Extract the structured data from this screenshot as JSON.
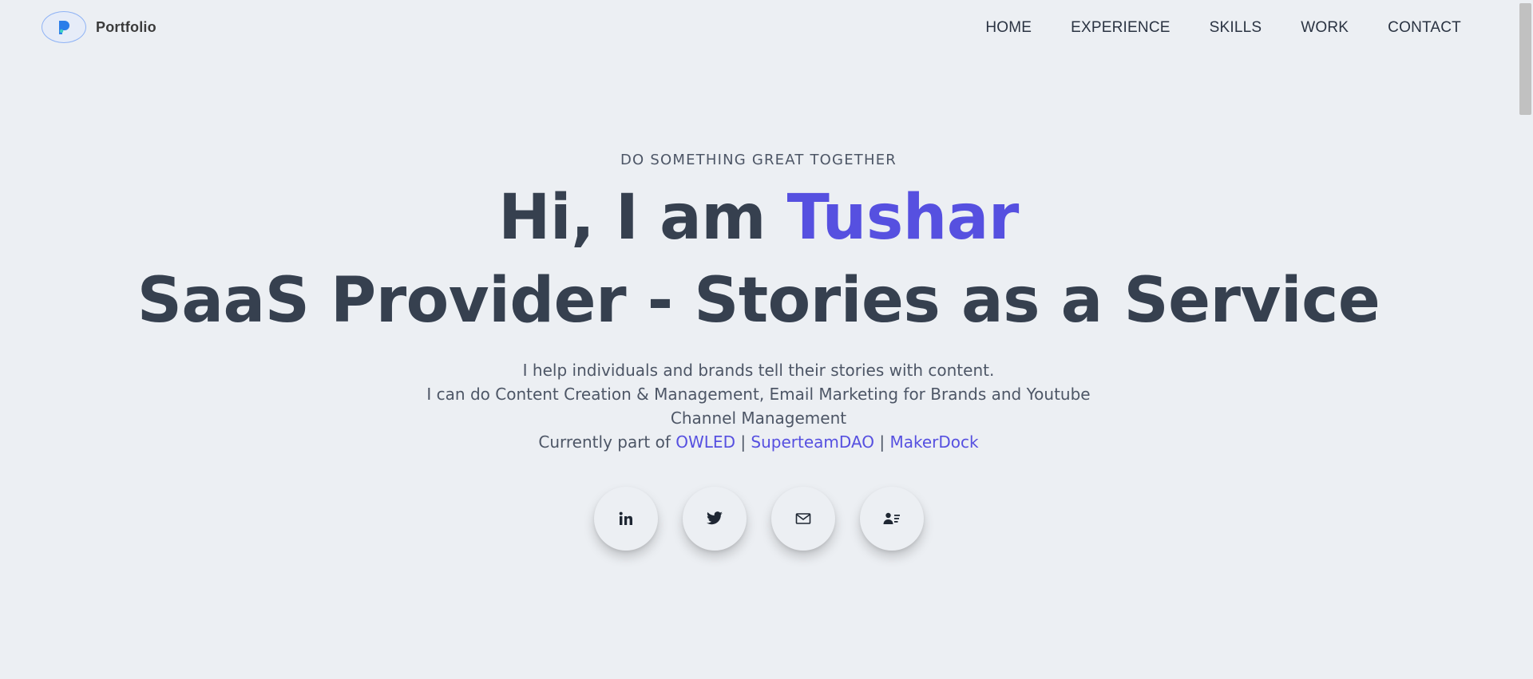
{
  "header": {
    "logo_text": "Portfolio",
    "nav": [
      "HOME",
      "EXPERIENCE",
      "SKILLS",
      "WORK",
      "CONTACT"
    ]
  },
  "hero": {
    "eyebrow": "DO SOMETHING GREAT TOGETHER",
    "greeting": "Hi, I am ",
    "name": "Tushar",
    "title": "SaaS Provider - Stories as a Service",
    "desc_line1": "I help individuals and brands tell their stories with content.",
    "desc_line2": "I can do Content Creation & Management, Email Marketing for Brands and Youtube Channel Management",
    "current_prefix": "Currently part of ",
    "orgs": [
      "OWLED",
      "SuperteamDAO",
      "MakerDock"
    ],
    "separator": " | "
  },
  "socials": [
    {
      "icon": "linkedin-icon"
    },
    {
      "icon": "twitter-icon"
    },
    {
      "icon": "mail-icon"
    },
    {
      "icon": "contact-card-icon"
    }
  ],
  "colors": {
    "background": "#eceff3",
    "accent": "#5650e0",
    "heading": "#36404f",
    "body_text": "#4d5666"
  }
}
